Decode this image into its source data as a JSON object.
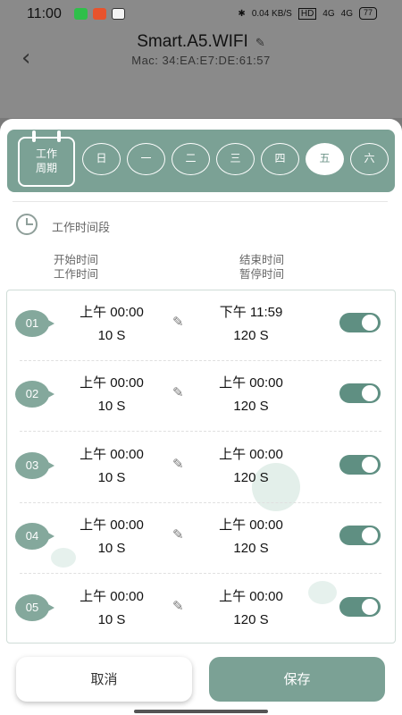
{
  "status": {
    "time": "11:00",
    "network": "0.04 KB/S",
    "hd": "HD",
    "signal1": "4G",
    "signal2": "4G",
    "battery": "77"
  },
  "header": {
    "back_icon": "chevron-left-icon",
    "title": "Smart.A5.WIFI",
    "edit_icon": "pencil-icon",
    "mac": "Mac:   34:EA:E7:DE:61:57"
  },
  "week": {
    "label_line1": "工作",
    "label_line2": "周期",
    "days": [
      "日",
      "一",
      "二",
      "三",
      "四",
      "五",
      "六"
    ],
    "selected": "五"
  },
  "section": {
    "title": "工作时间段",
    "col_start_1": "开始时间",
    "col_start_2": "工作时间",
    "col_end_1": "结束时间",
    "col_end_2": "暂停时间"
  },
  "rows": [
    {
      "id": "01",
      "start": "上午 00:00",
      "work": "10 S",
      "end": "下午 11:59",
      "pause": "120 S",
      "enabled": true
    },
    {
      "id": "02",
      "start": "上午 00:00",
      "work": "10 S",
      "end": "上午 00:00",
      "pause": "120 S",
      "enabled": true
    },
    {
      "id": "03",
      "start": "上午 00:00",
      "work": "10 S",
      "end": "上午 00:00",
      "pause": "120 S",
      "enabled": true
    },
    {
      "id": "04",
      "start": "上午 00:00",
      "work": "10 S",
      "end": "上午 00:00",
      "pause": "120 S",
      "enabled": true
    },
    {
      "id": "05",
      "start": "上午 00:00",
      "work": "10 S",
      "end": "上午 00:00",
      "pause": "120 S",
      "enabled": true
    }
  ],
  "buttons": {
    "cancel": "取消",
    "save": "保存"
  },
  "colors": {
    "accent": "#7ba195",
    "toggle": "#5f8f82",
    "badge": "#84a89c"
  }
}
